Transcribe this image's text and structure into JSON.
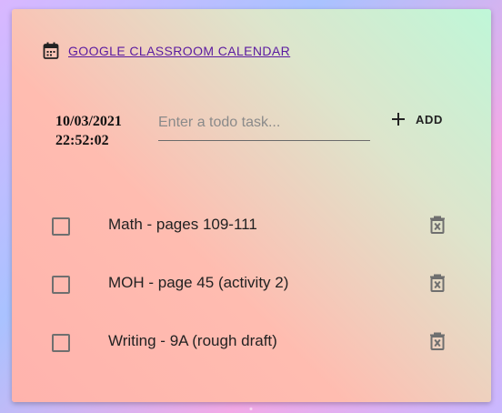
{
  "header": {
    "title": "GOOGLE CLASSROOM CALENDAR",
    "icon": "calendar-icon"
  },
  "datetime": {
    "date": "10/03/2021",
    "time": "22:52:02"
  },
  "input": {
    "placeholder": "Enter a todo task...",
    "value": ""
  },
  "add_button": {
    "label": "ADD",
    "icon": "plus-icon"
  },
  "tasks": [
    {
      "label": "Math - pages 109-111",
      "checked": false
    },
    {
      "label": "MOH - page 45 (activity 2)",
      "checked": false
    },
    {
      "label": "Writing - 9A (rough draft)",
      "checked": false
    }
  ],
  "delete_icon": "trash-icon",
  "colors": {
    "link": "#5a1aa0",
    "card_left": "#ffb3ad",
    "card_right": "#bff7d8"
  }
}
